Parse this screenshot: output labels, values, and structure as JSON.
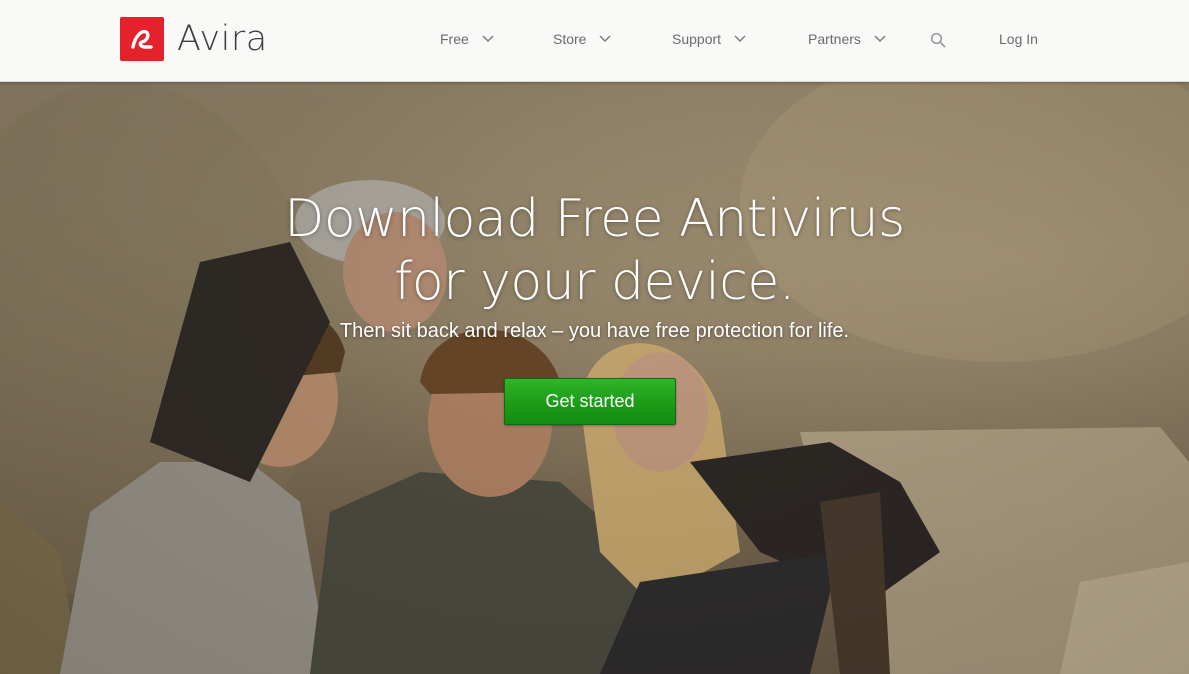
{
  "brand": {
    "name": "Avira",
    "color": "#e3222b"
  },
  "nav": {
    "items": [
      {
        "label": "Free",
        "icon": "chevron-down-icon"
      },
      {
        "label": "Store",
        "icon": "chevron-down-icon"
      },
      {
        "label": "Support",
        "icon": "chevron-down-icon"
      },
      {
        "label": "Partners",
        "icon": "chevron-down-icon"
      }
    ],
    "search_icon": "search-icon",
    "login_label": "Log In"
  },
  "hero": {
    "headline_line1": "Download Free Antivirus",
    "headline_line2": "for your device.",
    "subheadline": "Then sit back and relax – you have free protection for life.",
    "cta_label": "Get started",
    "cta_color": "#1a9a16"
  }
}
